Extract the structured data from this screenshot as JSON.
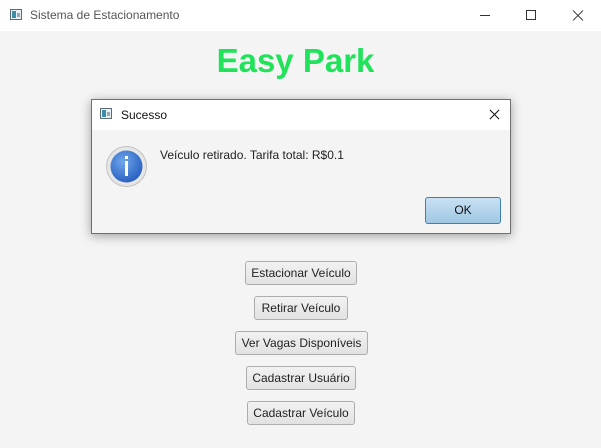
{
  "window": {
    "title": "Sistema de Estacionamento"
  },
  "main": {
    "headline": "Easy Park",
    "menu": [
      {
        "label": "Estacionar Veículo"
      },
      {
        "label": "Retirar Veículo"
      },
      {
        "label": "Ver Vagas Disponíveis"
      },
      {
        "label": "Cadastrar Usuário"
      },
      {
        "label": "Cadastrar Veículo"
      }
    ]
  },
  "dialog": {
    "title": "Sucesso",
    "message": "Veículo retirado. Tarifa total: R$0.1",
    "ok_label": "OK",
    "icon": "information-icon"
  },
  "colors": {
    "headline": "#21e35a",
    "ok_button": "#a9cde8",
    "info_icon": "#2f6fc9"
  }
}
